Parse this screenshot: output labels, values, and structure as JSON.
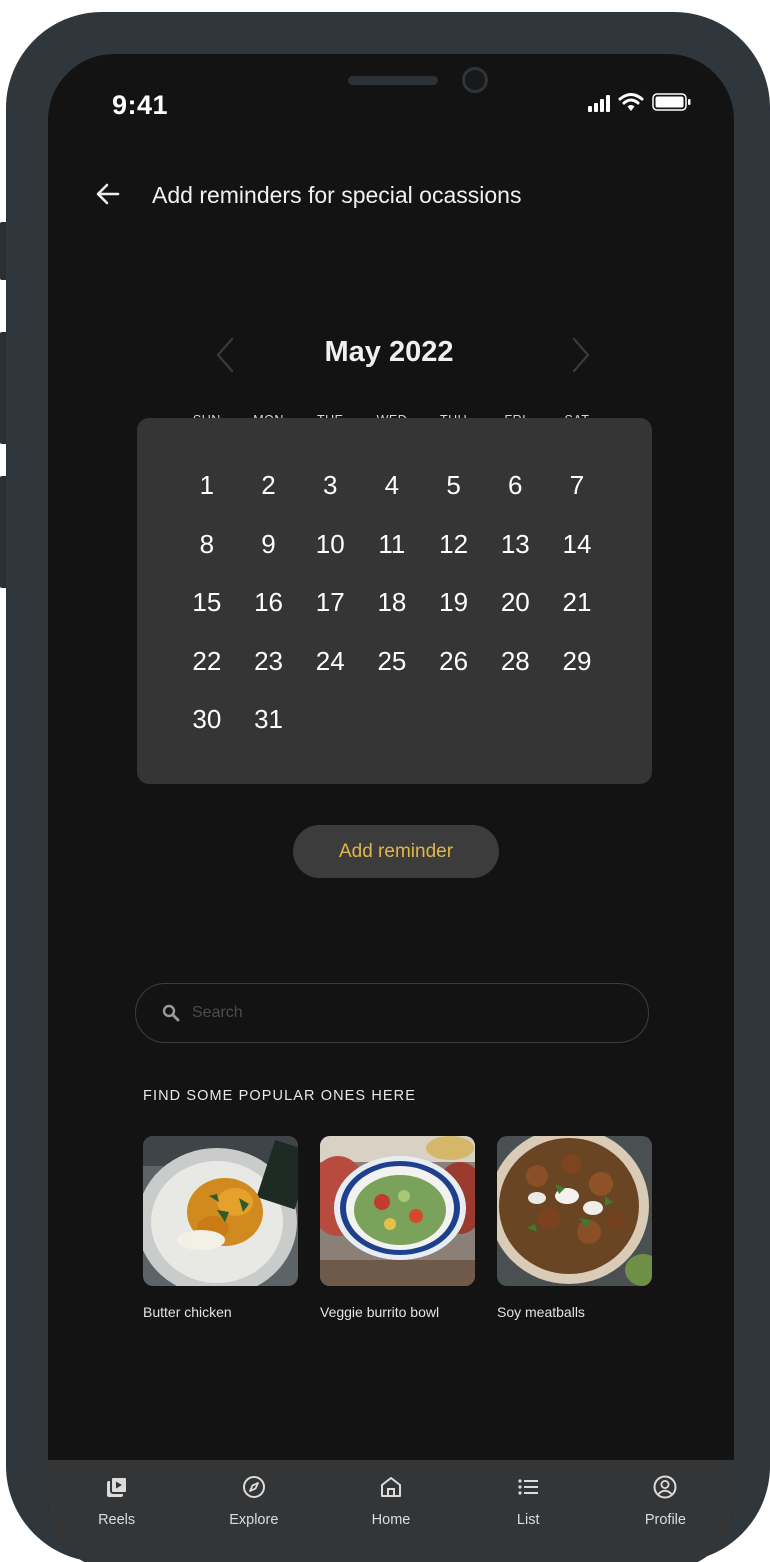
{
  "status_bar": {
    "time": "9:41"
  },
  "header": {
    "title": "Add reminders for special ocassions"
  },
  "calendar": {
    "month_label": "May 2022",
    "weekdays": [
      "SUN",
      "MON",
      "TUE",
      "WED",
      "THU",
      "FRI",
      "SAT"
    ],
    "days": [
      "1",
      "2",
      "3",
      "4",
      "5",
      "6",
      "7",
      "8",
      "9",
      "10",
      "11",
      "12",
      "13",
      "14",
      "15",
      "16",
      "17",
      "18",
      "19",
      "20",
      "21",
      "22",
      "23",
      "24",
      "25",
      "26",
      "28",
      "29",
      "30",
      "31"
    ]
  },
  "reminder_button": {
    "label": "Add reminder"
  },
  "search": {
    "placeholder": "Search"
  },
  "popular": {
    "heading": "FIND SOME POPULAR ONES HERE",
    "items": [
      {
        "title": "Butter chicken"
      },
      {
        "title": "Veggie burrito bowl"
      },
      {
        "title": "Soy meatballs"
      }
    ]
  },
  "bottom_nav": {
    "items": [
      {
        "label": "Reels",
        "icon": "reels-icon"
      },
      {
        "label": "Explore",
        "icon": "compass-icon"
      },
      {
        "label": "Home",
        "icon": "home-icon"
      },
      {
        "label": "List",
        "icon": "list-icon"
      },
      {
        "label": "Profile",
        "icon": "profile-icon"
      }
    ]
  },
  "colors": {
    "screen_background": "#131314",
    "calendar_card": "#353536",
    "accent": "#e0b74a",
    "nav_background": "#343536"
  }
}
